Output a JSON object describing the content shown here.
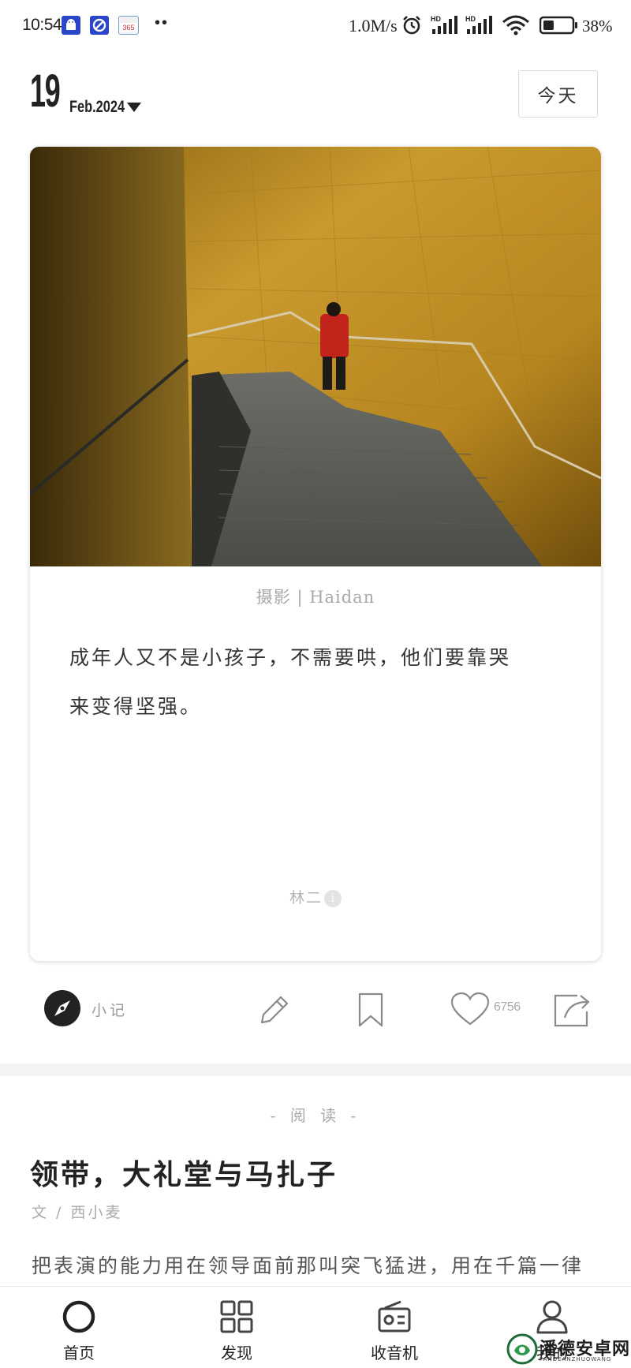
{
  "status_bar": {
    "time": "10:54",
    "calendar_number": "365",
    "more_indicator": "••",
    "network_speed": "1.0M/s",
    "signal_label_1": "HD",
    "signal_label_2": "HD",
    "battery_percent": "38%",
    "battery_level": 0.38
  },
  "date_header": {
    "day": "19",
    "month_year": "Feb.2024"
  },
  "today_button": {
    "label": "今天"
  },
  "card": {
    "photo_credit": "摄影 | Haidan",
    "quote_line_1": "成年人又不是小孩子，不需要哄，他们要靠哭",
    "quote_line_2": "来变得坚强。",
    "author": "林二",
    "author_info_icon": "i"
  },
  "actions": {
    "note_label": "小记",
    "like_count": "6756"
  },
  "reading": {
    "section_label": "- 阅 读 -",
    "title": "领带，大礼堂与马扎子",
    "byline": "文 / 西小麦",
    "excerpt": "把表演的能力用在领导面前那叫突飞猛进，用在千篇一律"
  },
  "tab_bar": {
    "tabs": [
      {
        "label": "首页",
        "icon": "home-ring-icon"
      },
      {
        "label": "发现",
        "icon": "grid-icon"
      },
      {
        "label": "收音机",
        "icon": "radio-icon"
      },
      {
        "label": "我的",
        "icon": "person-icon"
      }
    ]
  },
  "watermark": {
    "text": "潘德安卓网",
    "subtext": "PANDEANZHUOWANG"
  },
  "colors": {
    "accent": "#222222",
    "muted_text": "#aaaaaa",
    "divider": "#f3f3f3"
  }
}
